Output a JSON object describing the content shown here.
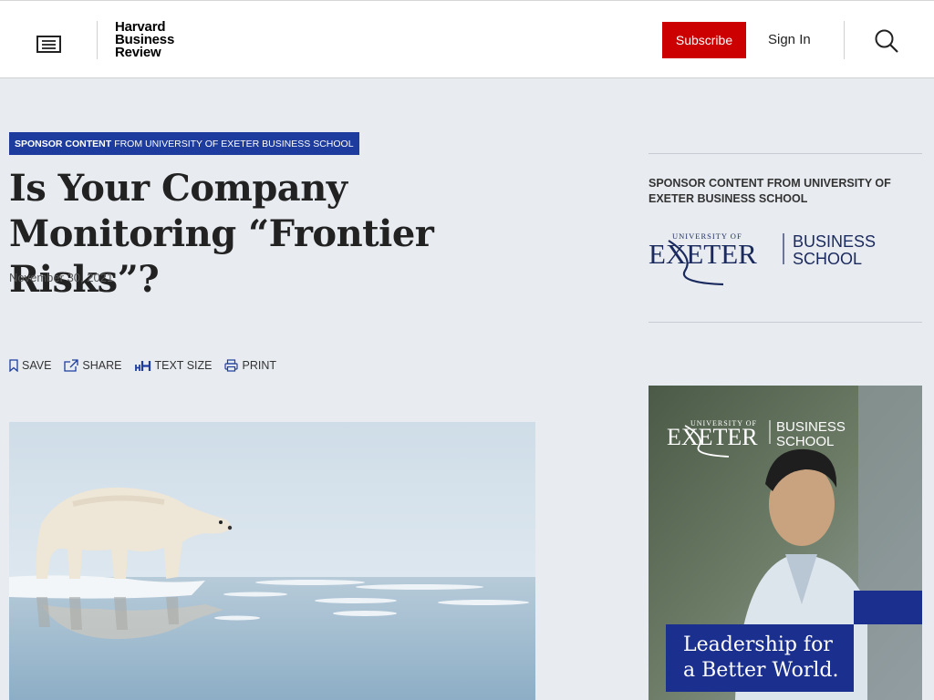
{
  "header": {
    "logo_line1": "Harvard",
    "logo_line2": "Business",
    "logo_line3": "Review",
    "subscribe_label": "Subscribe",
    "signin_label": "Sign In",
    "menu_icon": "menu-icon",
    "search_icon": "search-icon"
  },
  "article": {
    "sponsor_tag_bold": "SPONSOR CONTENT",
    "sponsor_tag_rest": "FROM UNIVERSITY OF EXETER BUSINESS SCHOOL",
    "title": "Is Your Company Monitoring “Frontier Risks”?",
    "date": "November 30, 2021",
    "tools": {
      "save": "SAVE",
      "share": "SHARE",
      "text_size": "TEXT SIZE",
      "print": "PRINT"
    }
  },
  "sidebar": {
    "heading": "SPONSOR CONTENT FROM UNIVERSITY OF EXETER BUSINESS SCHOOL",
    "logo": {
      "top": "UNIVERSITY OF",
      "main": "EXETER",
      "right1": "BUSINESS",
      "right2": "SCHOOL"
    },
    "ad": {
      "logo_top": "UNIVERSITY OF",
      "logo_main": "EXETER",
      "logo_right1": "BUSINESS",
      "logo_right2": "SCHOOL",
      "tagline1": "Leadership for",
      "tagline2": "a Better World."
    }
  },
  "colors": {
    "brand_red": "#cc0000",
    "sponsor_blue": "#1d3c9e",
    "exeter_navy": "#1b2f8f",
    "page_bg": "#e8ecf1"
  }
}
